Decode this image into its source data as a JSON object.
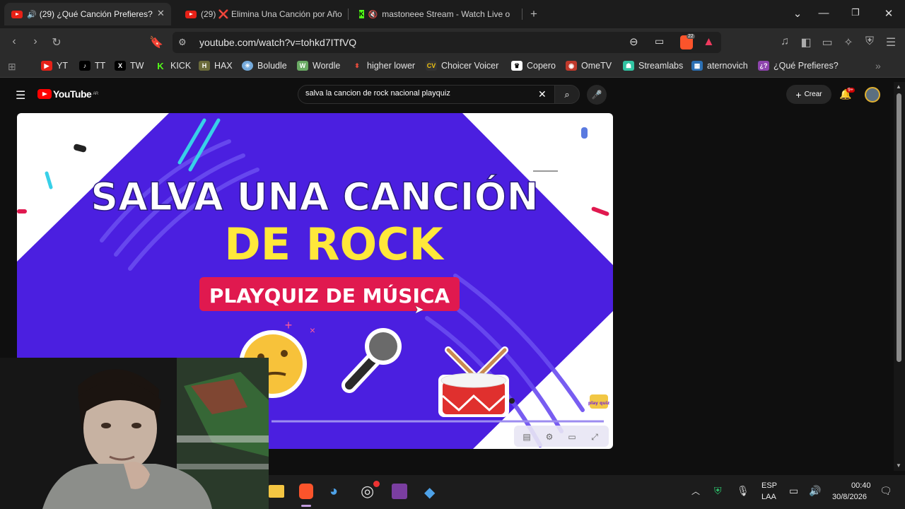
{
  "tabs": [
    {
      "label": "(29) ¿Qué Canción Prefieres?"
    },
    {
      "label": "(29) ❌ Elimina Una Canción por Año"
    },
    {
      "label": "mastoneee Stream - Watch Live o"
    }
  ],
  "address_bar": {
    "url": "youtube.com/watch?v=tohkd7ITfVQ",
    "extension_badge": "22"
  },
  "bookmarks": [
    {
      "label": "YT"
    },
    {
      "label": "TT"
    },
    {
      "label": "TW"
    },
    {
      "label": "KICK"
    },
    {
      "label": "HAX"
    },
    {
      "label": "Boludle"
    },
    {
      "label": "Wordle"
    },
    {
      "label": "higher lower"
    },
    {
      "label": "Choicer Voicer"
    },
    {
      "label": "Copero"
    },
    {
      "label": "OmeTV"
    },
    {
      "label": "Streamlabs"
    },
    {
      "label": "aternovich"
    },
    {
      "label": "¿Qué Prefieres?"
    }
  ],
  "youtube": {
    "logo_text": "YouTube",
    "region": "AR",
    "search_value": "salva la cancion de rock nacional playquiz",
    "create_label": "Crear",
    "notification_count": "9+"
  },
  "video": {
    "title_line1": "SALVA UNA CANCIÓN",
    "title_line2": "DE ROCK",
    "banner": "PLAYQUIZ DE MÚSICA",
    "watermark": "play quiz"
  },
  "taskbar": {
    "language": "ESP",
    "layout": "LAA",
    "time": "00:40",
    "date": "30/8/2026"
  },
  "colors": {
    "youtube_red": "#ff0000",
    "video_purple": "#4b1fe0",
    "banner_red": "#e0194f",
    "title_yellow": "#ffe83a"
  }
}
